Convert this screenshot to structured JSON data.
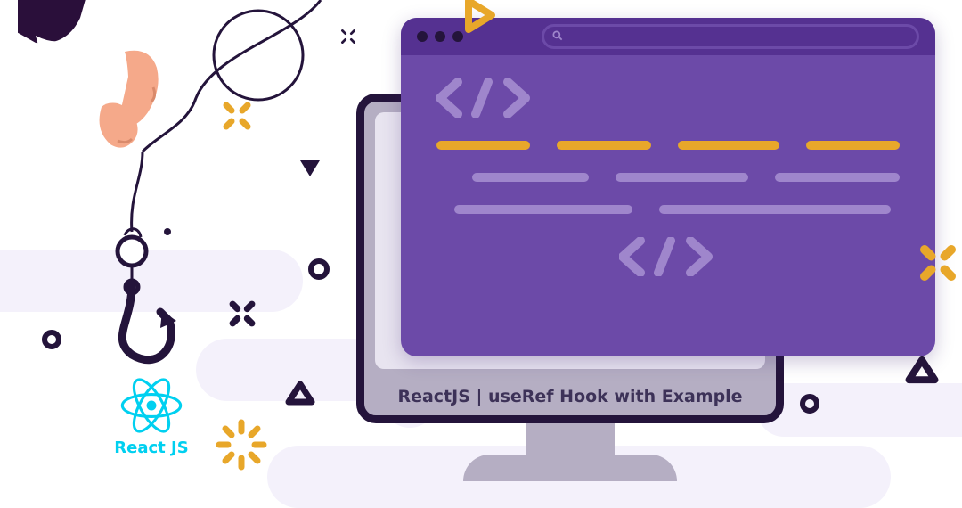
{
  "monitorLabel": "ReactJS | useRef Hook with Example",
  "reactLabel": "React JS",
  "colors": {
    "purpleDark": "#553191",
    "purple": "#6c4aa8",
    "purpleLight": "#9f86cc",
    "orange": "#e8a72a",
    "ink": "#24143b",
    "cyan": "#00d0f0",
    "skin": "#f5a98a",
    "sleeve": "#2a0f3a"
  }
}
